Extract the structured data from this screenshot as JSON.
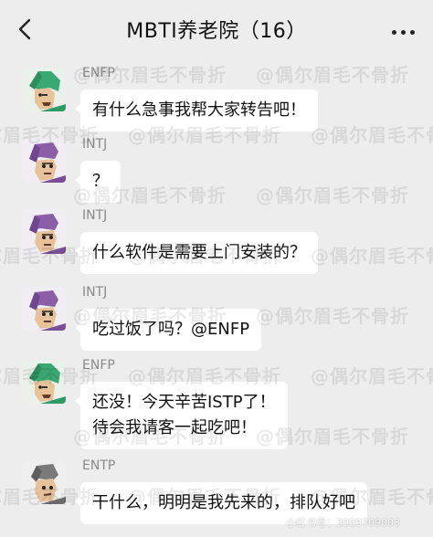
{
  "header": {
    "title": "MBTI养老院（16）",
    "back_icon": "chevron-left-icon",
    "more_icon": "more-dots-icon"
  },
  "watermark": {
    "text": "@偶尔眉毛不骨折",
    "footer": "小红书号：3009709003"
  },
  "messages": [
    {
      "sender": "ENFP",
      "lines": [
        "有什么急事我帮大家转告吧！"
      ],
      "avatar": "enfp-avatar",
      "avatar_color": "#3aa872"
    },
    {
      "sender": "INTJ",
      "lines": [
        "？"
      ],
      "avatar": "intj-avatar",
      "avatar_color": "#8b5fa8"
    },
    {
      "sender": "INTJ",
      "lines": [
        "什么软件是需要上门安装的？"
      ],
      "avatar": "intj-avatar",
      "avatar_color": "#8b5fa8"
    },
    {
      "sender": "INTJ",
      "lines": [
        "吃过饭了吗？@ENFP"
      ],
      "avatar": "intj-avatar",
      "avatar_color": "#8b5fa8"
    },
    {
      "sender": "ENFP",
      "lines": [
        "还没！今天辛苦ISTP了！",
        "待会我请客一起吃吧！"
      ],
      "avatar": "enfp-avatar",
      "avatar_color": "#3aa872"
    },
    {
      "sender": "ENTP",
      "lines": [
        "干什么，明明是我先来的，排队好吧"
      ],
      "avatar": "entp-avatar",
      "avatar_color": "#7a7a7a"
    }
  ]
}
